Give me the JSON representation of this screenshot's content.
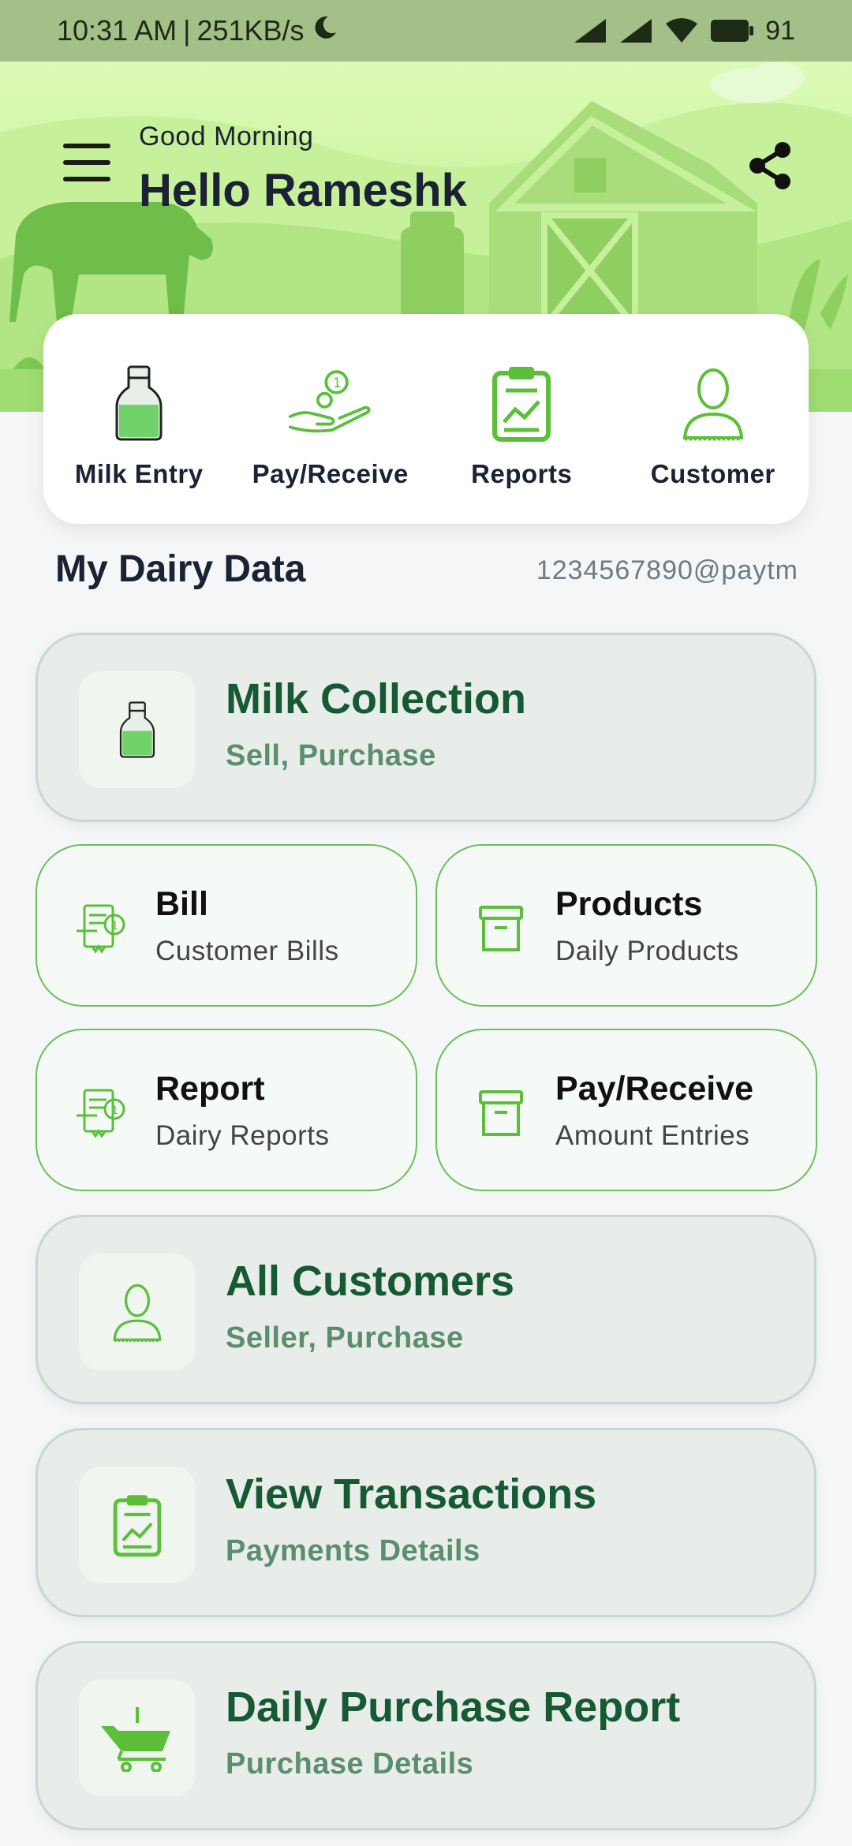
{
  "status_bar": {
    "time": "10:31 AM",
    "net_speed": "251KB/s",
    "battery": "91"
  },
  "header": {
    "greeting": "Good Morning",
    "name": "Hello Rameshk"
  },
  "quick_actions": [
    {
      "label": "Milk Entry",
      "icon": "milk-bottle-icon"
    },
    {
      "label": "Pay/Receive",
      "icon": "hand-coin-icon"
    },
    {
      "label": "Reports",
      "icon": "clipboard-chart-icon"
    },
    {
      "label": "Customer",
      "icon": "person-icon"
    }
  ],
  "section": {
    "title": "My Dairy Data",
    "upi": "1234567890@paytm"
  },
  "cards": {
    "milk_collection": {
      "title": "Milk Collection",
      "subtitle": "Sell, Purchase",
      "icon": "milk-bottle-icon"
    },
    "bill": {
      "title": "Bill",
      "subtitle": "Customer Bills",
      "icon": "receipt-icon"
    },
    "products": {
      "title": "Products",
      "subtitle": "Daily Products",
      "icon": "archive-box-icon"
    },
    "report": {
      "title": "Report",
      "subtitle": "Dairy Reports",
      "icon": "receipt-icon"
    },
    "pay_receive": {
      "title": "Pay/Receive",
      "subtitle": "Amount Entries",
      "icon": "archive-box-icon"
    },
    "all_customers": {
      "title": "All Customers",
      "subtitle": "Seller, Purchase",
      "icon": "person-icon"
    },
    "view_transactions": {
      "title": "View Transactions",
      "subtitle": "Payments Details",
      "icon": "clipboard-chart-icon"
    },
    "daily_purchase": {
      "title": "Daily Purchase Report",
      "subtitle": "Purchase Details",
      "icon": "shopping-cart-icon"
    }
  },
  "colors": {
    "status_bar": "#a5bf88",
    "accent_green": "#5bbf3a",
    "card_title": "#155a33",
    "card_subtitle": "#5b8e6e"
  }
}
